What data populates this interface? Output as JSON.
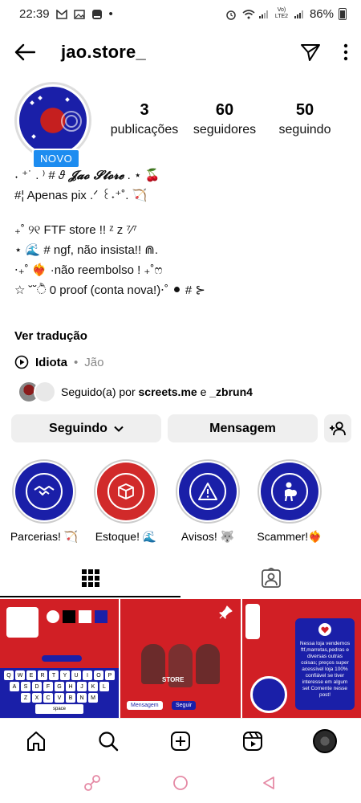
{
  "status_bar": {
    "time": "22:39",
    "notif_dot": "•",
    "battery": "86%",
    "signal_label": "Vo) LTE2"
  },
  "header": {
    "username": "jao.store_"
  },
  "profile": {
    "badge": "NOVO",
    "stats": [
      {
        "value": "3",
        "label": "publicações"
      },
      {
        "value": "60",
        "label": "seguidores"
      },
      {
        "value": "50",
        "label": "seguindo"
      }
    ]
  },
  "bio": {
    "line1": "˖ ⁺˙ . ⁾ # 𝜗  ",
    "name": "𝓙𝓪𝓸 𝓢𝓽𝓸𝓻𝓮",
    "line1_end": " . ⋆ 🍒",
    "line2": "#¦ Apenas pix .ᐟ ꒰˖⁺˚. 🏹",
    "line3": "₊˚ ୨୧ FTF store !! ᶻ z ⁷⁄⁷",
    "line4": "⋆ 🌊 # ngf, não insista!! ⋒.",
    "line5": "⋅₊˚ ❤️‍🔥 ·não reembolso ! ₊˚ෆ",
    "line6": "☆ ˘˘ੈ 0 proof (conta nova!)⋅˚ ⚫ # ⊱"
  },
  "translate_label": "Ver tradução",
  "music": {
    "title": "Idiota",
    "separator": "•",
    "artist": "Jão"
  },
  "followed_by": {
    "prefix": "Seguido(a) por ",
    "user1": "screets.me",
    "conj": " e ",
    "user2": "_zbrun4"
  },
  "actions": {
    "following": "Seguindo",
    "message": "Mensagem"
  },
  "highlights": [
    {
      "label": "Parcerias! 🏹"
    },
    {
      "label": "Estoque! 🌊"
    },
    {
      "label": "Avisos! 🐺"
    },
    {
      "label": "Scammer!❤️‍🔥"
    }
  ],
  "posts": {
    "post1_space": "space",
    "post1_keys_row1": [
      "Q",
      "W",
      "E",
      "R",
      "T",
      "Y",
      "U",
      "I",
      "O",
      "P"
    ],
    "post1_keys_row2": [
      "A",
      "S",
      "D",
      "F",
      "G",
      "H",
      "J",
      "K",
      "L"
    ],
    "post1_keys_row3": [
      "Z",
      "X",
      "C",
      "V",
      "B",
      "N",
      "M"
    ],
    "post2_brand": "STORE",
    "post2_btn1": "Mensagem",
    "post2_btn2": "Seguir",
    "post3_text": "Nessa loja vendemos ftf,marretas,pedras e diversas outras coisas; preços super acessível loja 100% confiável se tiver interesse em algum set Comente nesse post!"
  },
  "colors": {
    "accent_blue": "#1d8cf0",
    "brand_blue": "#1a1fa8",
    "brand_red": "#d11f25"
  }
}
